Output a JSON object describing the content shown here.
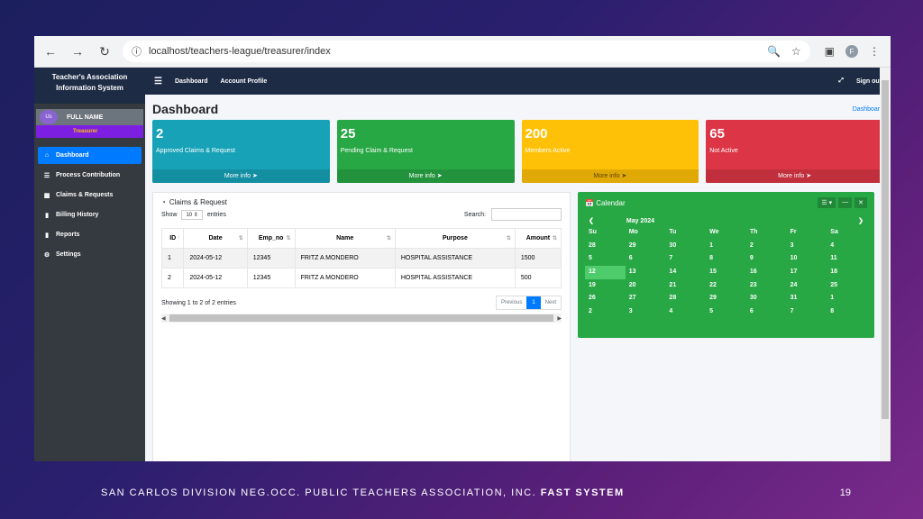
{
  "browser": {
    "url": "localhost/teachers-league/treasurer/index",
    "profile_initial": "F"
  },
  "sidebar": {
    "brand_line1": "Teacher's Association",
    "brand_line2": "Information System",
    "user_avatar_alt": "Us",
    "user_name": "FULL NAME",
    "user_role": "Treasurer",
    "items": [
      {
        "label": "Dashboard",
        "icon": "home-icon"
      },
      {
        "label": "Process Contribution",
        "icon": "layers-icon"
      },
      {
        "label": "Claims & Requests",
        "icon": "money-icon"
      },
      {
        "label": "Billing History",
        "icon": "book-icon"
      },
      {
        "label": "Reports",
        "icon": "book-icon"
      },
      {
        "label": "Settings",
        "icon": "gear-icon"
      }
    ]
  },
  "topbar": {
    "links": [
      "Dashboard",
      "Account Profile"
    ],
    "signout": "Sign out"
  },
  "header": {
    "title": "Dashboard",
    "breadcrumb": "Dashboard"
  },
  "boxes": [
    {
      "value": "2",
      "label": "Approved Claims & Request",
      "footer": "More info",
      "color": "#17a2b8"
    },
    {
      "value": "25",
      "label": "Pending Claim & Request",
      "footer": "More info",
      "color": "#28a745"
    },
    {
      "value": "200",
      "label": "Members Active",
      "footer": "More info",
      "color": "#ffc107"
    },
    {
      "value": "65",
      "label": "Not Active",
      "footer": "More info",
      "color": "#dc3545"
    }
  ],
  "claims": {
    "title": "Claims & Request",
    "show_label": "Show",
    "entries_value": "10",
    "entries_label": "entries",
    "search_label": "Search:",
    "columns": [
      "ID",
      "Date",
      "Emp_no",
      "Name",
      "Purpose",
      "Amount"
    ],
    "rows": [
      [
        "1",
        "2024-05-12",
        "12345",
        "FRITZ A MONDERO",
        "HOSPITAL ASSISTANCE",
        "1500"
      ],
      [
        "2",
        "2024-05-12",
        "12345",
        "FRITZ A MONDERO",
        "HOSPITAL ASSISTANCE",
        "500"
      ]
    ],
    "info": "Showing 1 to 2 of 2 entries",
    "prev": "Previous",
    "page": "1",
    "next": "Next"
  },
  "calendar": {
    "title": "Calendar",
    "month": "May 2024",
    "weekdays": [
      "Su",
      "Mo",
      "Tu",
      "We",
      "Th",
      "Fr",
      "Sa"
    ],
    "days": [
      "28",
      "29",
      "30",
      "1",
      "2",
      "3",
      "4",
      "5",
      "6",
      "7",
      "8",
      "9",
      "10",
      "11",
      "12",
      "13",
      "14",
      "15",
      "16",
      "17",
      "18",
      "19",
      "20",
      "21",
      "22",
      "23",
      "24",
      "25",
      "26",
      "27",
      "28",
      "29",
      "30",
      "31",
      "1",
      "2",
      "3",
      "4",
      "5",
      "6",
      "7",
      "8"
    ],
    "today": "12"
  },
  "caption": {
    "text": "SAN CARLOS DIVISION NEG.OCC. PUBLIC TEACHERS ASSOCIATION, INC.",
    "bold": "FAST SYSTEM",
    "page_number": "19"
  }
}
